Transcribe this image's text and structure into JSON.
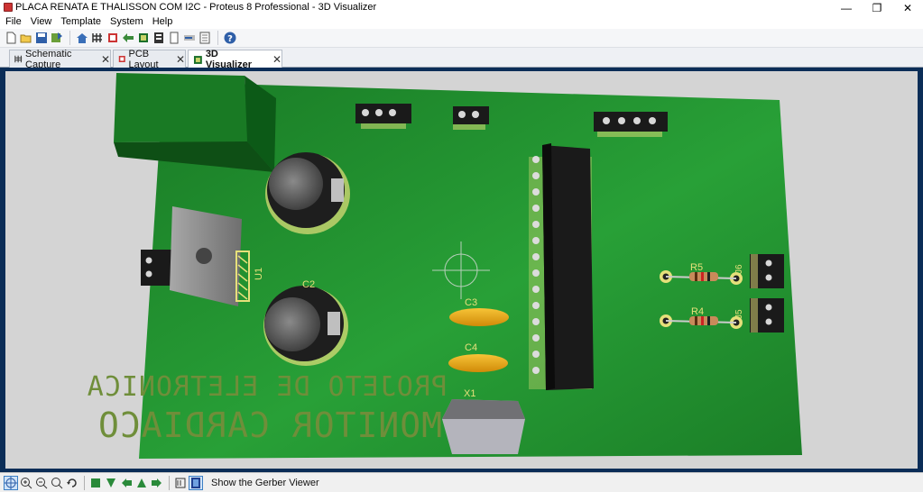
{
  "window": {
    "title": "PLACA RENATA E THALISSON COM I2C - Proteus 8 Professional - 3D Visualizer",
    "minimize": "—",
    "maximize": "❐",
    "close": "✕"
  },
  "menu": [
    "File",
    "View",
    "Template",
    "System",
    "Help"
  ],
  "tabs": [
    {
      "label": "Schematic Capture",
      "close": "✕"
    },
    {
      "label": "PCB Layout",
      "close": "✕"
    },
    {
      "label": "3D Visualizer",
      "close": "✕"
    }
  ],
  "board": {
    "labels": {
      "c2": "C2",
      "c3": "C3",
      "c4": "C4",
      "x1": "X1",
      "u1": "U1",
      "r5": "R5",
      "r4": "R4",
      "j6": "J6",
      "j5": "J5"
    },
    "silkscreen_line1": "PROJETO DE ELETRONICA",
    "silkscreen_line2": "MONITOR CARDIACO",
    "colors": {
      "board": "#1e8a2a",
      "board_light": "#2aa03a",
      "silk_text": "#6f8e3a",
      "copper_outline": "#e6e07a",
      "cap_yellow": "#f0ad1a"
    }
  },
  "status": {
    "text": "Show the Gerber Viewer"
  }
}
